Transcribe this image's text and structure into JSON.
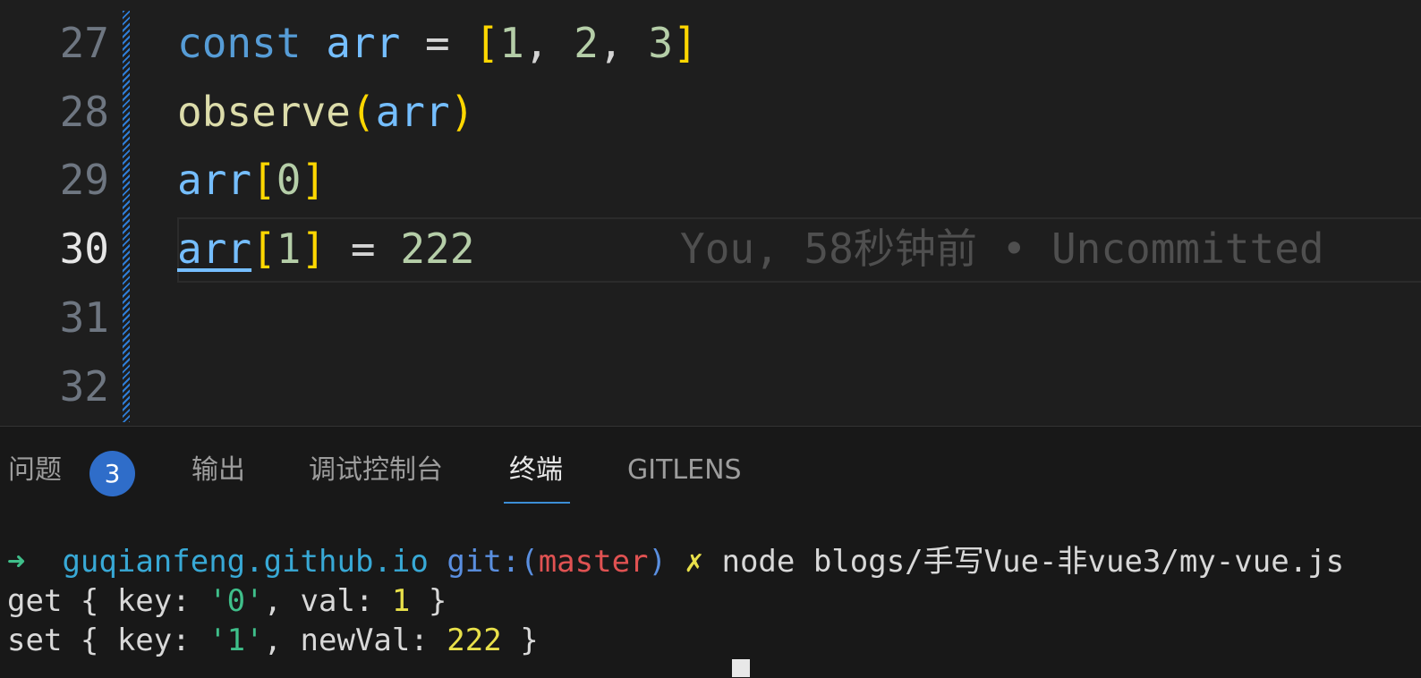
{
  "editor": {
    "line_numbers": [
      "27",
      "28",
      "29",
      "30",
      "31",
      "32"
    ],
    "active_line": "30",
    "lines": {
      "l27": {
        "kw": "const",
        "var": "arr",
        "eq": "=",
        "open": "[",
        "n1": "1",
        "c1": ",",
        "n2": "2",
        "c2": ",",
        "n3": "3",
        "close": "]"
      },
      "l28": {
        "fn": "observe",
        "open": "(",
        "var": "arr",
        "close": ")"
      },
      "l29": {
        "var": "arr",
        "open": "[",
        "n": "0",
        "close": "]"
      },
      "l30": {
        "var": "arr",
        "open": "[",
        "n": "1",
        "close": "]",
        "eq": "=",
        "val": "222"
      }
    },
    "blame": "You, 58秒钟前 • Uncommitted"
  },
  "panel": {
    "tabs": [
      {
        "label": "问题",
        "badge": "3"
      },
      {
        "label": "输出"
      },
      {
        "label": "调试控制台"
      },
      {
        "label": "终端",
        "active": true
      },
      {
        "label": "GITLENS"
      }
    ]
  },
  "terminal": {
    "prompt_arrow": "➜",
    "dir": "guqianfeng.github.io",
    "git_label": "git:",
    "paren_open": "(",
    "branch": "master",
    "paren_close": ")",
    "dirty_mark": "✗",
    "command": "node blogs/手写Vue-非vue3/my-vue.js",
    "out1": {
      "prefix": "get { key: ",
      "key": "'0'",
      "mid": ", val: ",
      "val": "1",
      "end": " }"
    },
    "out2": {
      "prefix": "set { key: ",
      "key": "'1'",
      "mid": ", newVal: ",
      "val": "222",
      "end": " }"
    }
  },
  "colors": {
    "accent": "#2f7ed8",
    "badge": "#2f6dc9",
    "terminal_green": "#3fbf8a",
    "terminal_red": "#e05252",
    "terminal_yellow": "#e8e04a"
  }
}
